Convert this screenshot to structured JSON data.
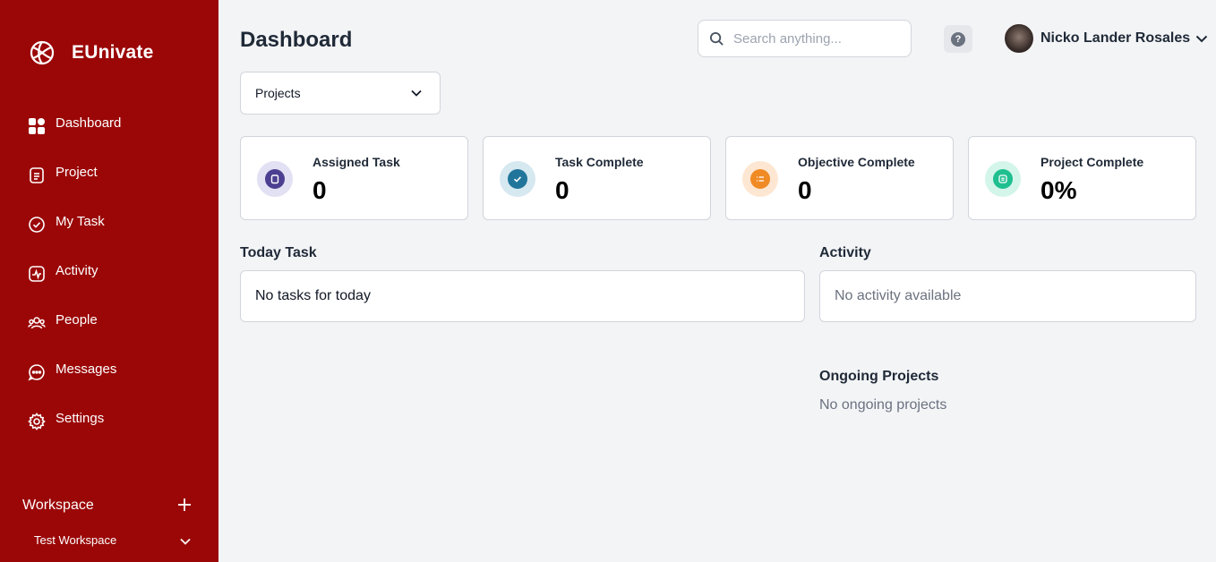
{
  "brand": {
    "name": "EUnivate"
  },
  "colors": {
    "sidebar": "#9b0707",
    "accent_purple": "#4c3f91",
    "accent_blue": "#21759b",
    "accent_orange": "#f08a24",
    "accent_green": "#1fbf8f"
  },
  "sidebar": {
    "items": [
      {
        "label": "Dashboard",
        "icon": "grid-icon"
      },
      {
        "label": "Project",
        "icon": "document-icon"
      },
      {
        "label": "My Task",
        "icon": "check-circle-icon"
      },
      {
        "label": "Activity",
        "icon": "activity-icon"
      },
      {
        "label": "People",
        "icon": "people-icon"
      },
      {
        "label": "Messages",
        "icon": "chat-icon"
      },
      {
        "label": "Settings",
        "icon": "gear-icon"
      }
    ],
    "workspace": {
      "title": "Workspace",
      "selected": "Test Workspace"
    }
  },
  "header": {
    "title": "Dashboard",
    "search_placeholder": "Search anything...",
    "help_label": "?",
    "user_name": "Nicko Lander Rosales"
  },
  "filter": {
    "selected": "Projects"
  },
  "cards": [
    {
      "label": "Assigned Task",
      "value": "0"
    },
    {
      "label": "Task Complete",
      "value": "0"
    },
    {
      "label": "Objective Complete",
      "value": "0"
    },
    {
      "label": "Project Complete",
      "value": "0%"
    }
  ],
  "today": {
    "title": "Today Task",
    "empty": "No tasks for today"
  },
  "activity": {
    "title": "Activity",
    "empty": "No activity available"
  },
  "ongoing": {
    "title": "Ongoing Projects",
    "empty": "No ongoing projects"
  }
}
